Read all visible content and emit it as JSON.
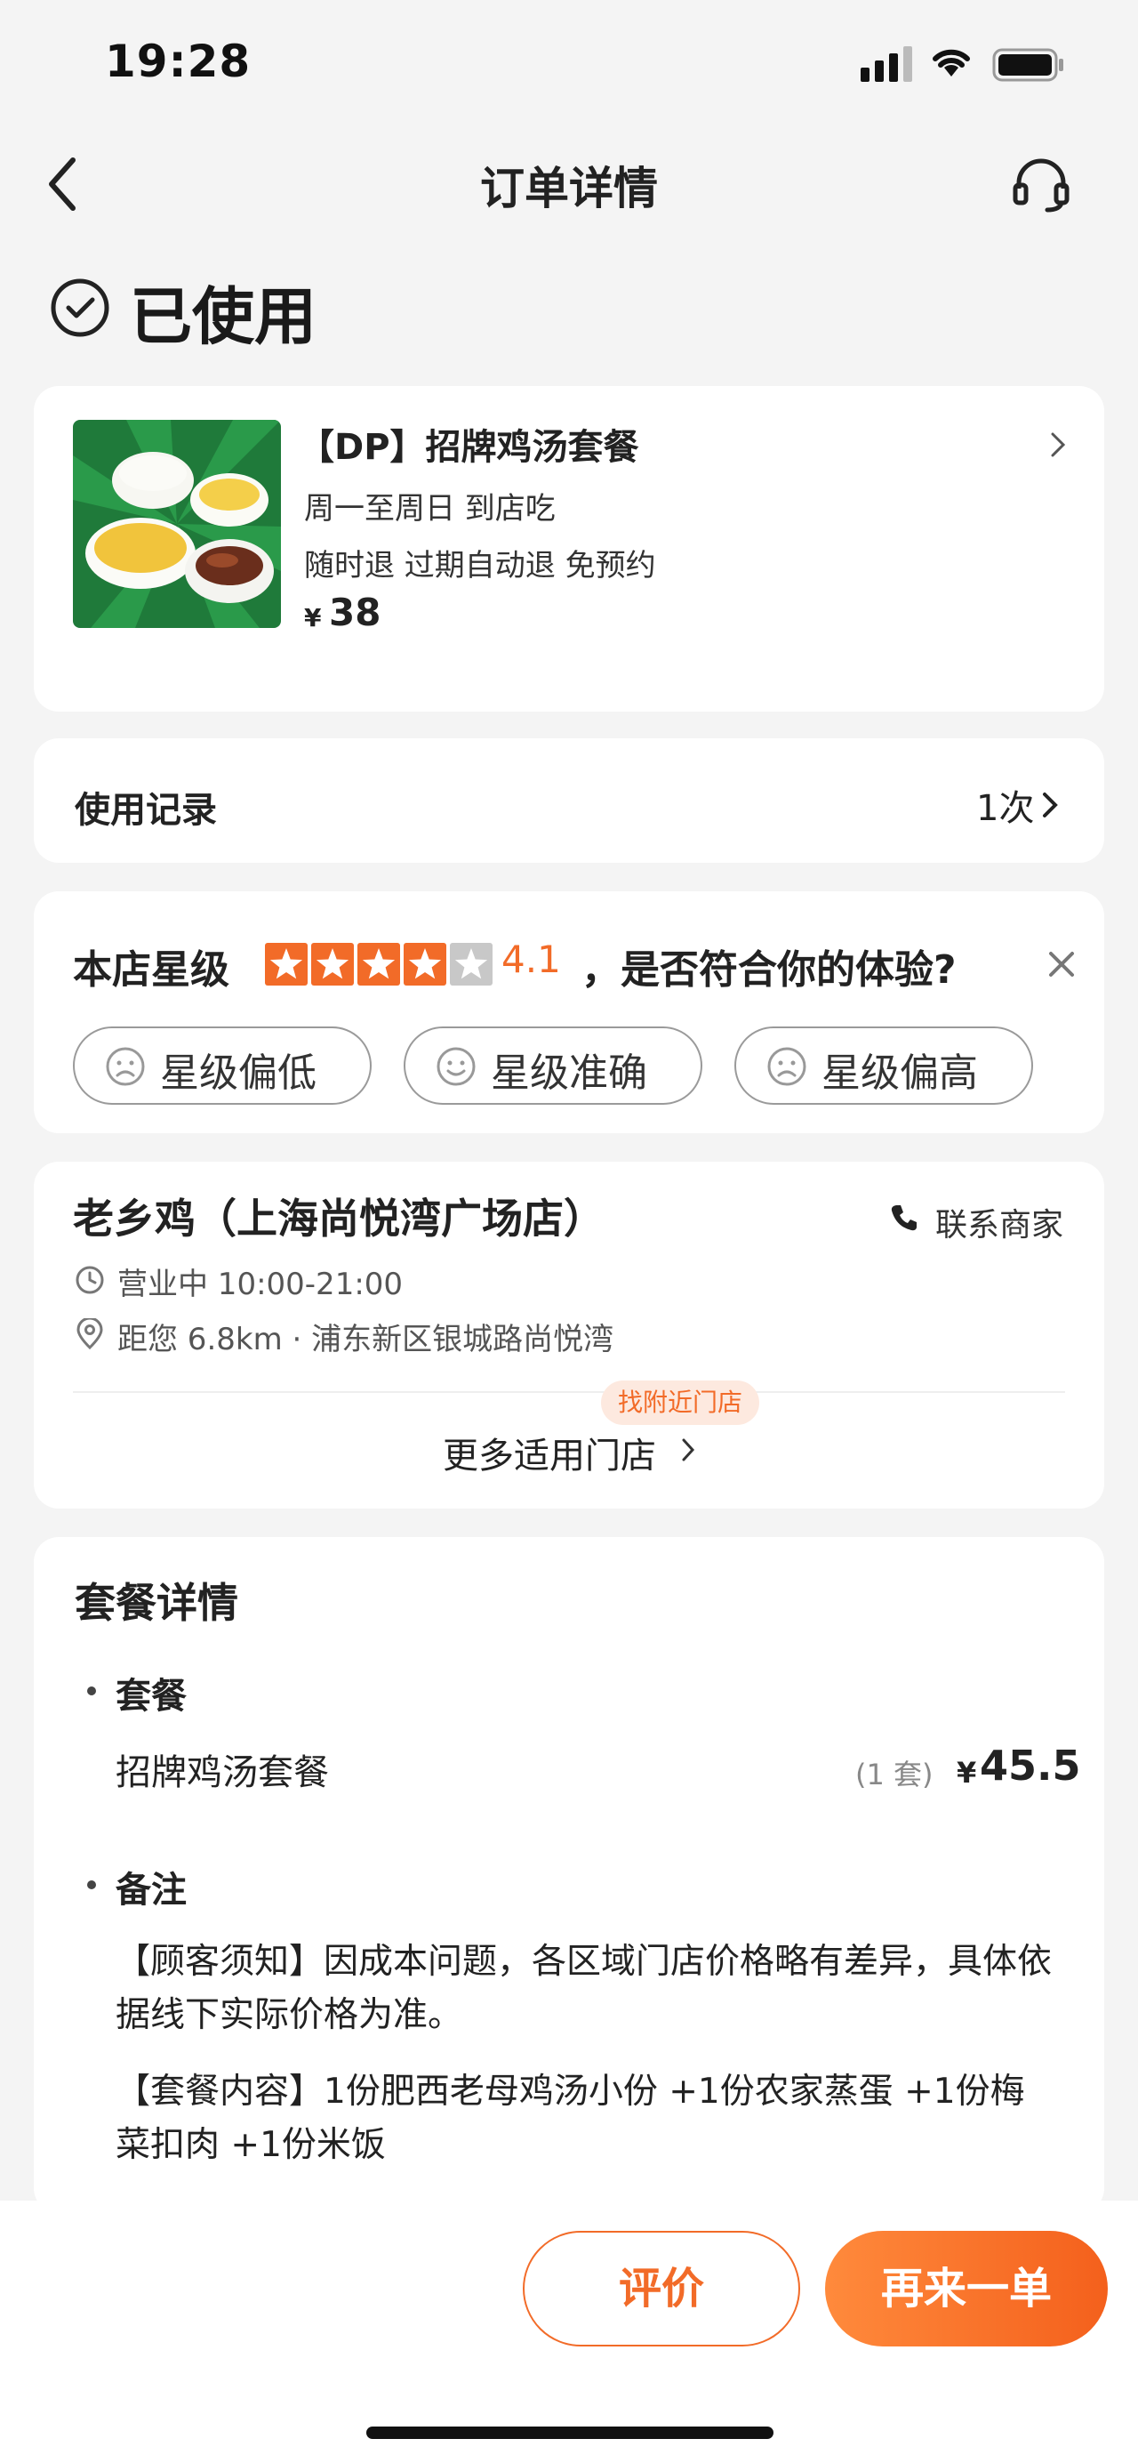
{
  "status_bar": {
    "time": "19:28"
  },
  "nav": {
    "title": "订单详情",
    "back_icon": "chevron-left-icon",
    "service_icon": "headset-icon"
  },
  "order_status": {
    "label": "已使用"
  },
  "product": {
    "title": "【DP】招牌鸡汤套餐",
    "line1": "周一至周日   到店吃",
    "line2": "随时退   过期自动退   免预约",
    "price_symbol": "¥",
    "price": "38"
  },
  "usage": {
    "label": "使用记录",
    "count": "1次"
  },
  "rating": {
    "label": "本店星级",
    "score": "4.1",
    "stars_filled": 4,
    "stars_total": 5,
    "question": "，是否符合你的体验?",
    "options": [
      "星级偏低",
      "星级准确",
      "星级偏高"
    ],
    "accent": "#f26b28"
  },
  "shop": {
    "name": "老乡鸡（上海尚悦湾广场店）",
    "contact": "联系商家",
    "hours": "营业中 10:00-21:00",
    "address": "距您 6.8km · 浦东新区银城路尚悦湾",
    "nearby_badge": "找附近门店",
    "more_stores": "更多适用门店"
  },
  "package": {
    "title": "套餐详情",
    "section_meal": "套餐",
    "item_name": "招牌鸡汤套餐",
    "item_qty": "(1 套)",
    "item_price_symbol": "¥",
    "item_price": "45.5",
    "section_notes": "备注",
    "note1": "【顾客须知】因成本问题，各区域门店价格略有差异，具体依据线下实际价格为准。",
    "note2": "【套餐内容】1份肥西老母鸡汤小份 +1份农家蒸蛋 +1份梅菜扣肉 +1份米饭"
  },
  "actions": {
    "review": "评价",
    "reorder": "再来一单"
  }
}
